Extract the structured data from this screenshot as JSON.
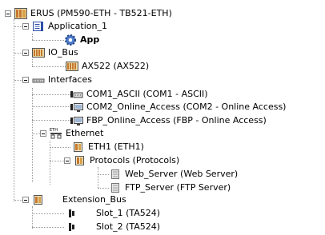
{
  "tree": {
    "root": "ERUS (PM590-ETH - TB521-ETH)",
    "application": "Application_1",
    "app": "App",
    "io_bus": "IO_Bus",
    "ax522": "AX522 (AX522)",
    "interfaces": "Interfaces",
    "com1": "COM1_ASCII (COM1 - ASCII)",
    "com2": "COM2_Online_Access (COM2 - Online Access)",
    "fbp": "FBP_Online_Access (FBP - Online Access)",
    "ethernet_icon_text": "ETH",
    "ethernet": "Ethernet",
    "eth1": "ETH1 (ETH1)",
    "protocols": "Protocols (Protocols)",
    "web_server": "Web_Server (Web Server)",
    "ftp_server": "FTP_Server (FTP Server)",
    "extension_bus": "Extension_Bus",
    "slot1": "Slot_1 (TA524)",
    "slot2": "Slot_2 (TA524)"
  }
}
